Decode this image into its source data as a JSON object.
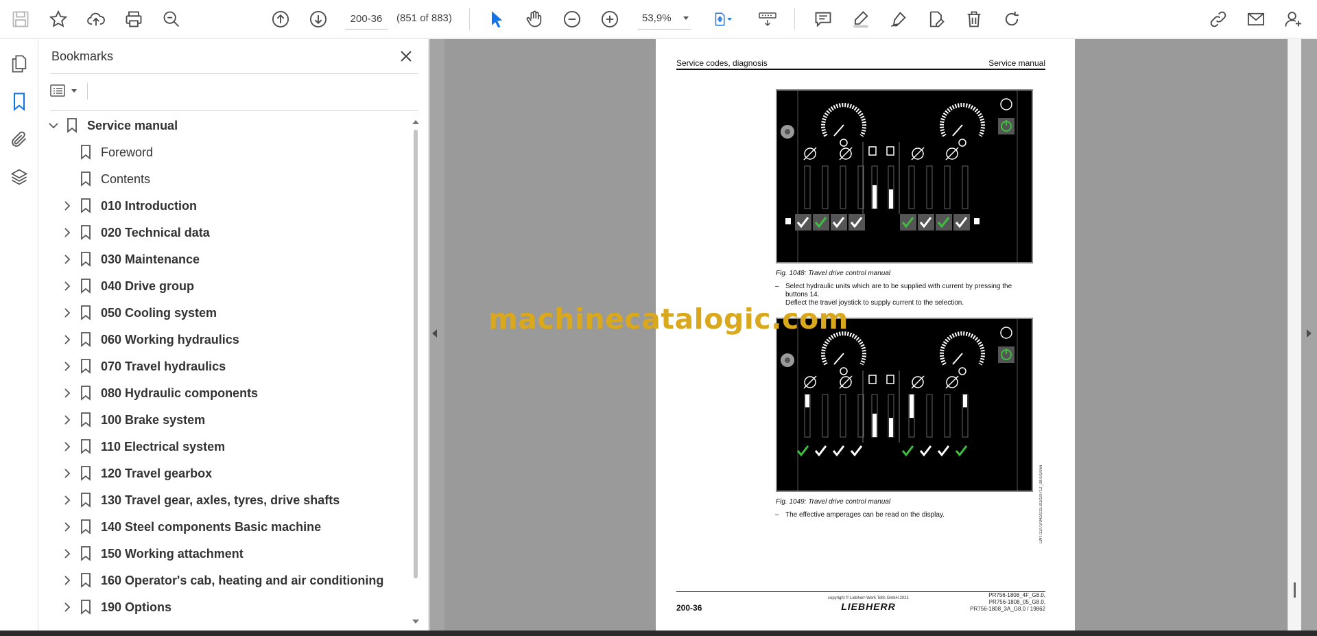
{
  "toolbar": {
    "page_value": "200-36",
    "page_count": "(851 of 883)",
    "zoom": "53,9%"
  },
  "bookmarks": {
    "title": "Bookmarks",
    "items": [
      {
        "label": "Service manual",
        "level": 0,
        "expanded": true,
        "bold": true
      },
      {
        "label": "Foreword",
        "level": 1,
        "bold": false
      },
      {
        "label": "Contents",
        "level": 1,
        "bold": false
      },
      {
        "label": "010 Introduction",
        "level": 1,
        "bold": true
      },
      {
        "label": "020 Technical data",
        "level": 1,
        "bold": true
      },
      {
        "label": "030 Maintenance",
        "level": 1,
        "bold": true
      },
      {
        "label": "040 Drive group",
        "level": 1,
        "bold": true
      },
      {
        "label": "050 Cooling system",
        "level": 1,
        "bold": true
      },
      {
        "label": "060 Working hydraulics",
        "level": 1,
        "bold": true
      },
      {
        "label": "070 Travel hydraulics",
        "level": 1,
        "bold": true
      },
      {
        "label": "080 Hydraulic components",
        "level": 1,
        "bold": true
      },
      {
        "label": "100 Brake system",
        "level": 1,
        "bold": true
      },
      {
        "label": "110 Electrical system",
        "level": 1,
        "bold": true
      },
      {
        "label": "120 Travel gearbox",
        "level": 1,
        "bold": true
      },
      {
        "label": "130 Travel gear, axles, tyres, drive shafts",
        "level": 1,
        "bold": true
      },
      {
        "label": "140 Steel components Basic machine",
        "level": 1,
        "bold": true
      },
      {
        "label": "150 Working attachment",
        "level": 1,
        "bold": true
      },
      {
        "label": "160 Operator's cab, heating and air conditioning",
        "level": 1,
        "bold": true
      },
      {
        "label": "190 Options",
        "level": 1,
        "bold": true
      }
    ]
  },
  "page": {
    "header_left": "Service codes, diagnosis",
    "header_right": "Service manual",
    "fig1_caption": "Fig. 1048: Travel drive control manual",
    "fig1_text_1": "Select hydraulic units which are to be supplied with current by pressing the buttons 14.",
    "fig1_text_2": "Deflect the travel joystick to supply current to the selection.",
    "fig2_caption": "Fig. 1049: Travel drive control manual",
    "fig2_text": "The effective amperages can be read on the display.",
    "fig2_code": "LWT/12/72/04/2013-2021/0712_09.0/1/0en",
    "footer_num": "200-36",
    "footer_copyright": "copyright © Liebherr-Werk Telfs GmbH 2021",
    "footer_logo": "LIEBHERR",
    "footer_models": [
      "PR756-1808_4F_G8.0,",
      "PR756-1808_05_G8.0,",
      "PR756-1808_3A_G8.0 / 19862"
    ]
  },
  "watermark": "machinecatalogic.com"
}
